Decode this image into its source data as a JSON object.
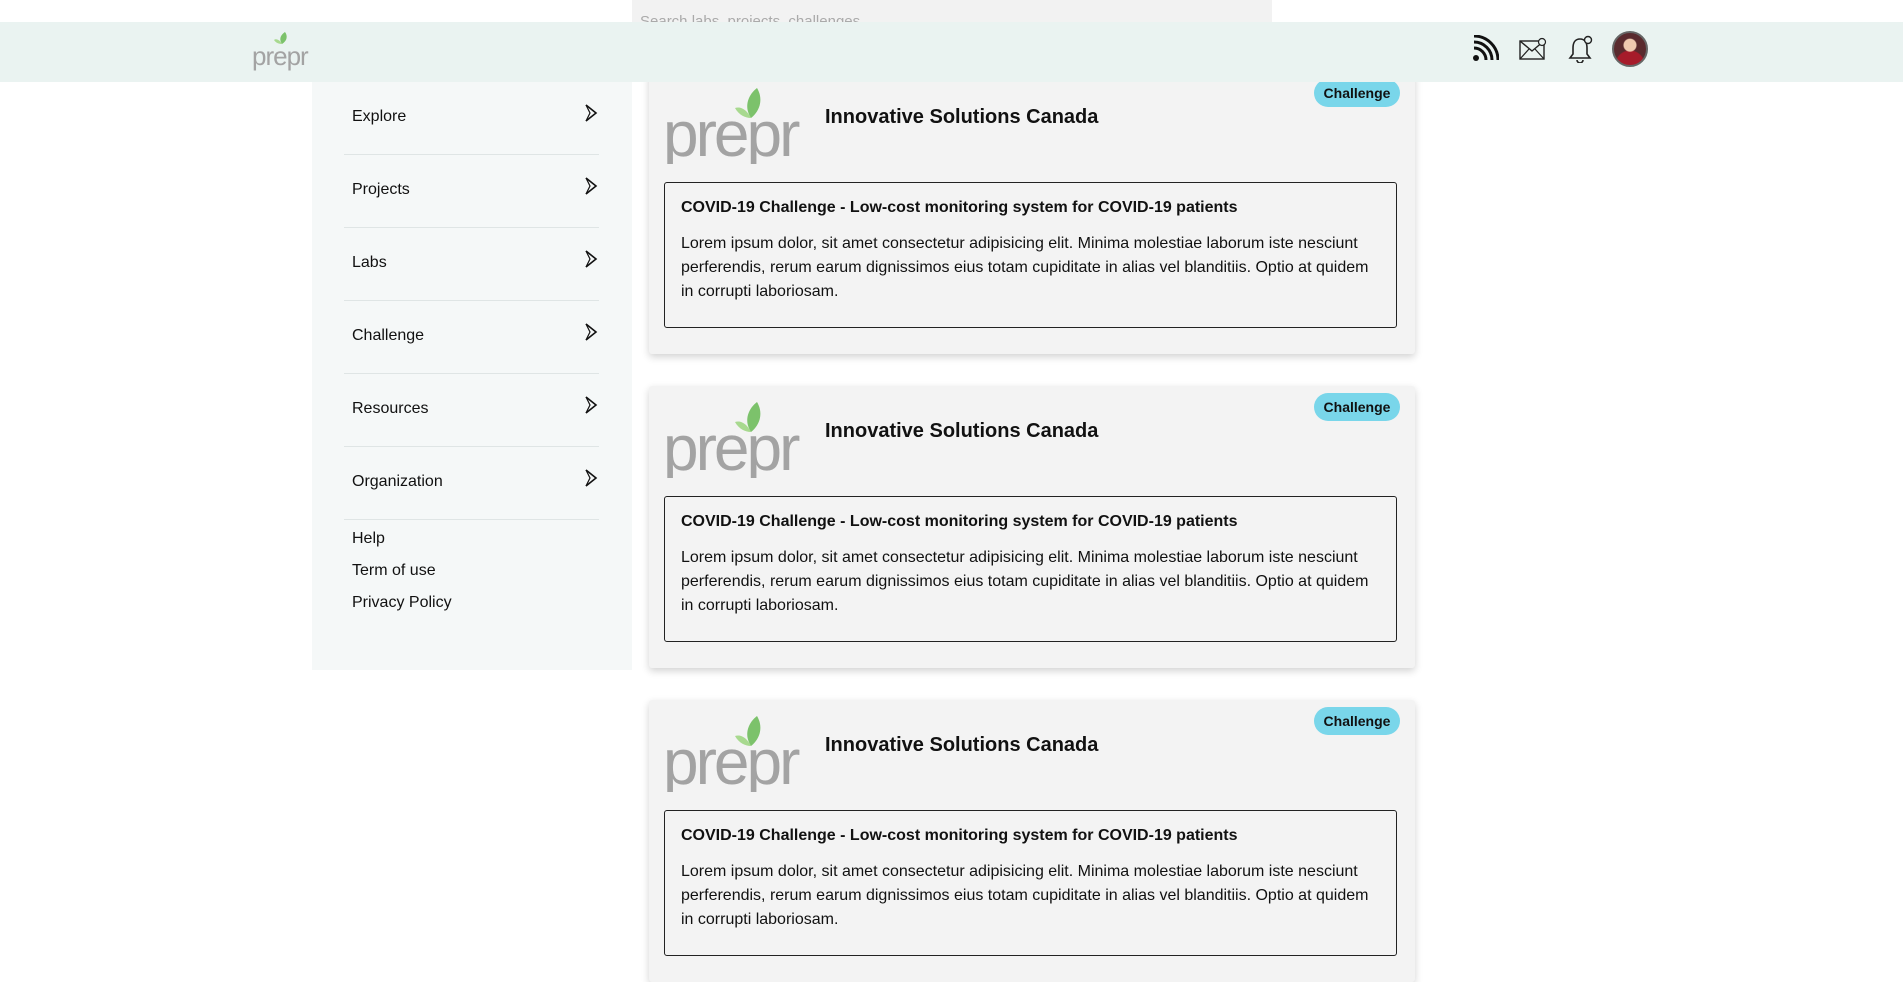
{
  "search": {
    "placeholder": "Search labs, projects, challenges"
  },
  "header": {
    "logo_text": "prepr",
    "icons": [
      "rss-icon",
      "mail-icon",
      "bell-icon",
      "avatar"
    ]
  },
  "sidebar": {
    "items": [
      {
        "label": "Explore"
      },
      {
        "label": "Projects"
      },
      {
        "label": "Labs"
      },
      {
        "label": "Challenge"
      },
      {
        "label": "Resources"
      },
      {
        "label": "Organization"
      }
    ],
    "footer_links": [
      {
        "label": "Help"
      },
      {
        "label": "Term of use"
      },
      {
        "label": "Privacy Policy"
      }
    ]
  },
  "cards": [
    {
      "logo_text": "prepr",
      "org": "Innovative Solutions Canada",
      "badge": "Challenge",
      "title": "COVID-19 Challenge - Low-cost monitoring system for COVID-19 patients",
      "desc": "Lorem ipsum dolor, sit amet consectetur adipisicing elit. Minima molestiae laborum iste nesciunt perferendis, rerum earum dignissimos eius totam cupiditate in alias vel blanditiis. Optio at quidem in corrupti laboriosam."
    },
    {
      "logo_text": "prepr",
      "org": "Innovative Solutions Canada",
      "badge": "Challenge",
      "title": "COVID-19 Challenge - Low-cost monitoring system for COVID-19 patients",
      "desc": "Lorem ipsum dolor, sit amet consectetur adipisicing elit. Minima molestiae laborum iste nesciunt perferendis, rerum earum dignissimos eius totam cupiditate in alias vel blanditiis. Optio at quidem in corrupti laboriosam."
    },
    {
      "logo_text": "prepr",
      "org": "Innovative Solutions Canada",
      "badge": "Challenge",
      "title": "COVID-19 Challenge - Low-cost monitoring system for COVID-19 patients",
      "desc": "Lorem ipsum dolor, sit amet consectetur adipisicing elit. Minima molestiae laborum iste nesciunt perferendis, rerum earum dignissimos eius totam cupiditate in alias vel blanditiis. Optio at quidem in corrupti laboriosam."
    }
  ],
  "colors": {
    "header_bg": "#eaf3f1",
    "sidebar_bg": "#f5f8f8",
    "card_bg": "#f3f3f3",
    "badge_bg": "#79d6ea",
    "logo_gray": "#a3a3a3",
    "logo_green": "#7cc26b"
  }
}
